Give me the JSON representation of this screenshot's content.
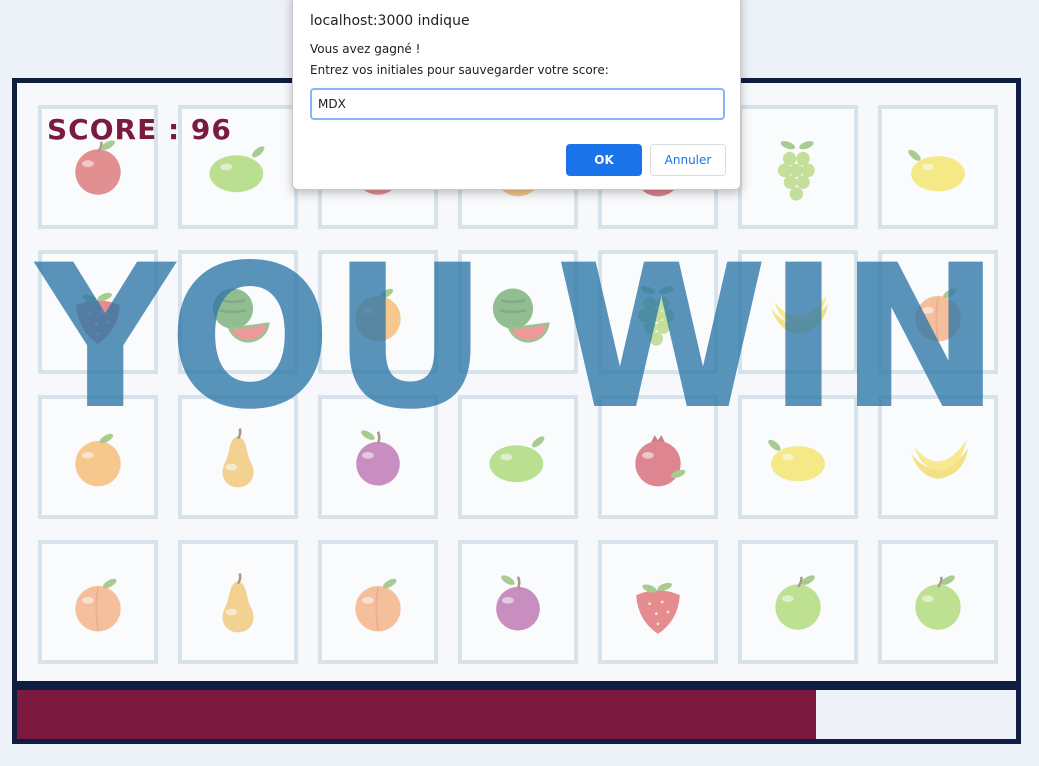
{
  "game": {
    "score_text": "SCORE : 96",
    "win_text": "YOU WIN",
    "timer_remaining_fraction": 0.8,
    "colors": {
      "board_border": "#0e1d40",
      "score": "#7a1b3d",
      "win_text": "#2c76a7",
      "timer_fill": "#7b1a3c",
      "card_border": "#bdd2de"
    },
    "cards": [
      [
        "apple-red",
        "lime",
        "apple-red",
        "orange",
        "pomegranate",
        "grapes",
        "lemon"
      ],
      [
        "strawberry",
        "watermelon",
        "orange",
        "watermelon",
        "grapes",
        "banana",
        "peach"
      ],
      [
        "orange",
        "pear",
        "plum",
        "lime",
        "pomegranate",
        "lemon",
        "banana"
      ],
      [
        "peach",
        "pear",
        "peach",
        "plum",
        "strawberry",
        "apple-green",
        "apple-green"
      ]
    ]
  },
  "dialog": {
    "title": "localhost:3000 indique",
    "message_line1": "Vous avez gagné !",
    "message_line2": "Entrez vos initiales pour sauvegarder votre score:",
    "input_value": "MDX",
    "ok_label": "OK",
    "cancel_label": "Annuler"
  }
}
